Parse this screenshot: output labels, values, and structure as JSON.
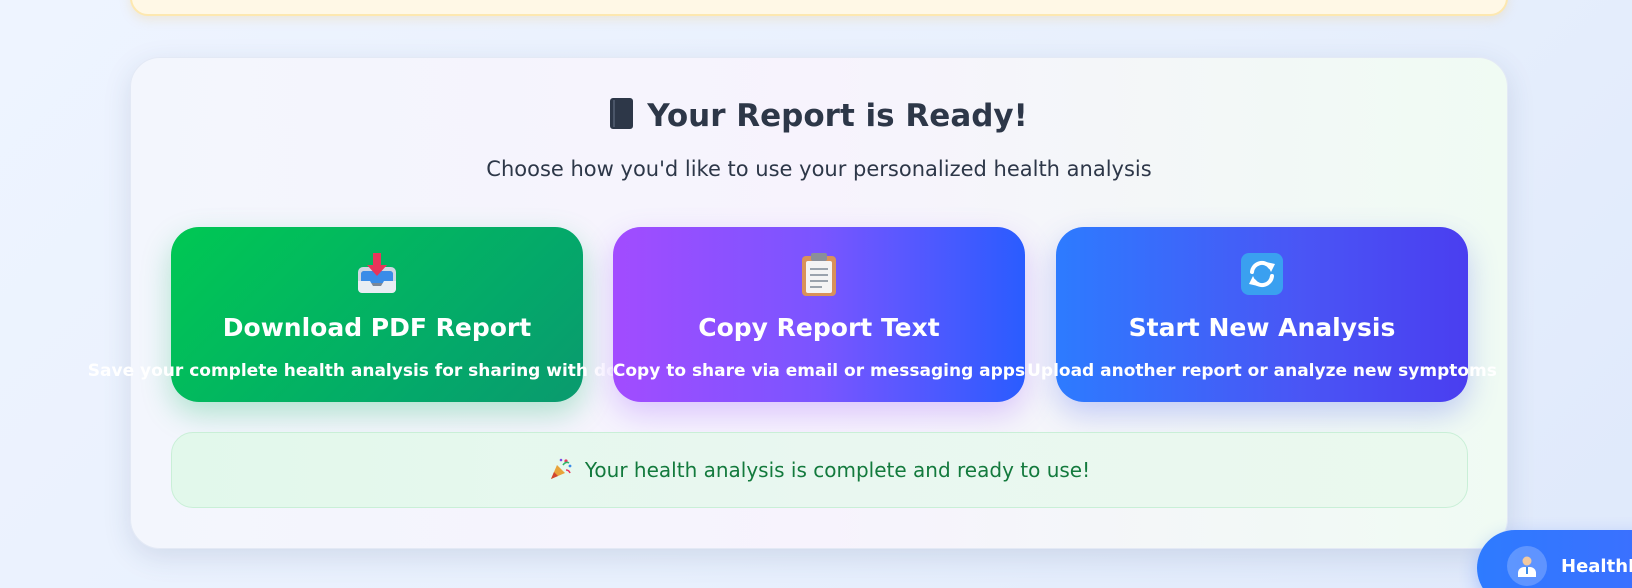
{
  "report": {
    "title": "Your Report is Ready!",
    "subtitle": "Choose how you'd like to use your personalized health analysis",
    "title_icon": "book-icon"
  },
  "actions": [
    {
      "icon": "inbox-download-icon",
      "title": "Download PDF Report",
      "description": "Save your complete health analysis for sharing with doctors",
      "color": "#00c853"
    },
    {
      "icon": "clipboard-icon",
      "title": "Copy Report Text",
      "description": "Copy to share via email or messaging apps",
      "color": "#a24cff"
    },
    {
      "icon": "refresh-icon",
      "title": "Start New Analysis",
      "description": "Upload another report or analyze new symptoms",
      "color": "#2d7bff"
    }
  ],
  "status": {
    "icon": "party-popper-icon",
    "message": "Your health analysis is complete and ready to use!",
    "color": "#137a3d"
  },
  "chat": {
    "label": "HealthM",
    "icon": "doctor-avatar-icon",
    "color": "#2e7bff"
  }
}
